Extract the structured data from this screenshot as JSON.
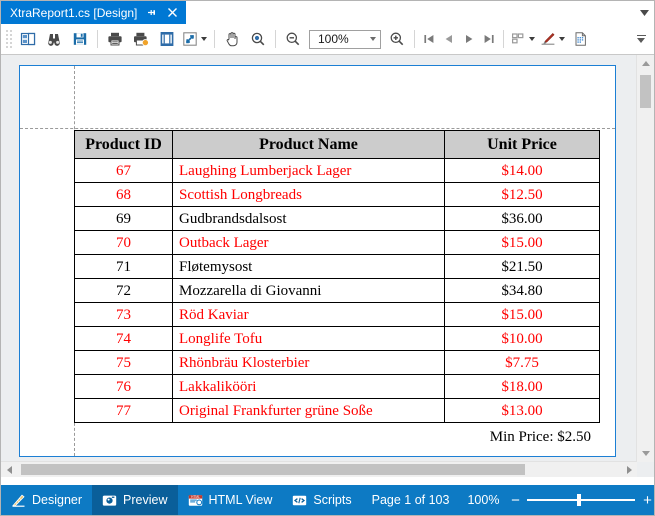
{
  "window": {
    "tab": {
      "title": "XtraReport1.cs [Design]",
      "pin_icon": "pin-icon",
      "close_icon": "close-icon"
    },
    "tabstrip_menu_icon": "chevron-down-icon"
  },
  "toolbar": {
    "buttons": [
      {
        "name": "document-map-button",
        "icon": "document-map-icon",
        "tooltip": "Document Map"
      },
      {
        "name": "search-button",
        "icon": "binoculars-icon",
        "tooltip": "Search"
      },
      {
        "name": "save-button",
        "icon": "floppy-disk-icon",
        "tooltip": "Save"
      },
      {
        "name": "print-button",
        "icon": "printer-icon",
        "tooltip": "Print"
      },
      {
        "name": "quick-print-button",
        "icon": "printer-page-icon",
        "tooltip": "Quick Print"
      },
      {
        "name": "page-setup-button",
        "icon": "page-setup-icon",
        "tooltip": "Page Setup"
      },
      {
        "name": "scale-button",
        "icon": "scale-arrow-icon",
        "tooltip": "Scale",
        "has_dropdown": true
      },
      {
        "name": "hand-tool-button",
        "icon": "hand-icon",
        "tooltip": "Hand Tool"
      },
      {
        "name": "magnifier-button",
        "icon": "magnifier-icon",
        "tooltip": "Magnifier"
      },
      {
        "name": "zoom-out-button",
        "icon": "zoom-out-icon",
        "tooltip": "Zoom Out"
      },
      {
        "name": "zoom-in-button",
        "icon": "zoom-in-icon",
        "tooltip": "Zoom In"
      },
      {
        "name": "first-page-button",
        "icon": "first-page-icon",
        "tooltip": "First Page"
      },
      {
        "name": "previous-page-button",
        "icon": "previous-page-icon",
        "tooltip": "Previous Page"
      },
      {
        "name": "next-page-button",
        "icon": "next-page-icon",
        "tooltip": "Next Page"
      },
      {
        "name": "last-page-button",
        "icon": "last-page-icon",
        "tooltip": "Last Page"
      },
      {
        "name": "multiple-pages-button",
        "icon": "multiple-pages-icon",
        "has_dropdown": true
      },
      {
        "name": "watermark-button",
        "icon": "watermark-icon",
        "has_dropdown": true
      },
      {
        "name": "export-document-button",
        "icon": "export-document-icon"
      }
    ],
    "zoom_combo": {
      "value": "100%",
      "caret_icon": "chevron-down-icon"
    },
    "overflow_icon": "toolbar-overflow-icon"
  },
  "report": {
    "headers": [
      "Product ID",
      "Product Name",
      "Unit Price"
    ],
    "rows": [
      {
        "id": "67",
        "name": "Laughing Lumberjack Lager",
        "price": "$14.00",
        "color": "red"
      },
      {
        "id": "68",
        "name": "Scottish Longbreads",
        "price": "$12.50",
        "color": "red"
      },
      {
        "id": "69",
        "name": "Gudbrandsdalsost",
        "price": "$36.00",
        "color": "black"
      },
      {
        "id": "70",
        "name": "Outback Lager",
        "price": "$15.00",
        "color": "red"
      },
      {
        "id": "71",
        "name": "Fløtemysost",
        "price": "$21.50",
        "color": "black"
      },
      {
        "id": "72",
        "name": "Mozzarella di Giovanni",
        "price": "$34.80",
        "color": "black"
      },
      {
        "id": "73",
        "name": "Röd Kaviar",
        "price": "$15.00",
        "color": "red"
      },
      {
        "id": "74",
        "name": "Longlife Tofu",
        "price": "$10.00",
        "color": "red"
      },
      {
        "id": "75",
        "name": "Rhönbräu Klosterbier",
        "price": "$7.75",
        "color": "red"
      },
      {
        "id": "76",
        "name": "Lakkalikööri",
        "price": "$18.00",
        "color": "red"
      },
      {
        "id": "77",
        "name": "Original Frankfurter grüne Soße",
        "price": "$13.00",
        "color": "red"
      }
    ],
    "summary": "Min Price: $2.50",
    "colors": {
      "red_text": "#ff0000",
      "black_text": "#000000",
      "header_bg": "#cccccc",
      "page_border": "#1c7fd4"
    }
  },
  "statusbar": {
    "tabs": [
      {
        "label": "Designer",
        "icon": "ruler-pencil-icon",
        "active": false
      },
      {
        "label": "Preview",
        "icon": "preview-camera-icon",
        "active": true
      },
      {
        "label": "HTML View",
        "icon": "html-view-icon",
        "active": false
      },
      {
        "label": "Scripts",
        "icon": "scripts-code-icon",
        "active": false
      }
    ],
    "page_info": "Page 1 of 103",
    "zoom_value": "100%",
    "zoom_minus": "−",
    "zoom_plus": "+",
    "accent_color": "#0d7ac4",
    "active_tab_color": "#0a5f9a"
  }
}
